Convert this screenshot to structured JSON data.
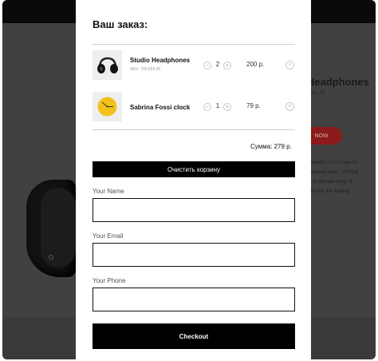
{
  "background": {
    "product_title": "Headphones",
    "product_sku": "SKU: 00",
    "buy_label": "NOW",
    "description_lines": [
      "checked out our new he",
      "improved lines\". We find",
      "ar or the real thing\" B",
      "lines we are leading"
    ]
  },
  "cart": {
    "title": "Ваш заказ:",
    "items": [
      {
        "name": "Studio Headphones",
        "sku": "SKU: 700.954.29",
        "qty": "2",
        "price": "200 р.",
        "thumb": "headphones-thumbnail"
      },
      {
        "name": "Sabrina Fossi clock",
        "sku": "",
        "qty": "1",
        "price": "79 р.",
        "thumb": "clock-thumbnail"
      }
    ],
    "minus_symbol": "−",
    "plus_symbol": "+",
    "remove_symbol": "×",
    "total": "Сумма: 279 р.",
    "clear_label": "Очистить корзину"
  },
  "form": {
    "name_label": "Your Name",
    "name_value": "",
    "email_label": "Your Email",
    "email_value": "",
    "phone_label": "Your Phone",
    "phone_value": "",
    "checkout_label": "Checkout"
  },
  "colors": {
    "accent": "#000000",
    "buy_button": "#8b1a1a",
    "overlay": "#414141"
  }
}
